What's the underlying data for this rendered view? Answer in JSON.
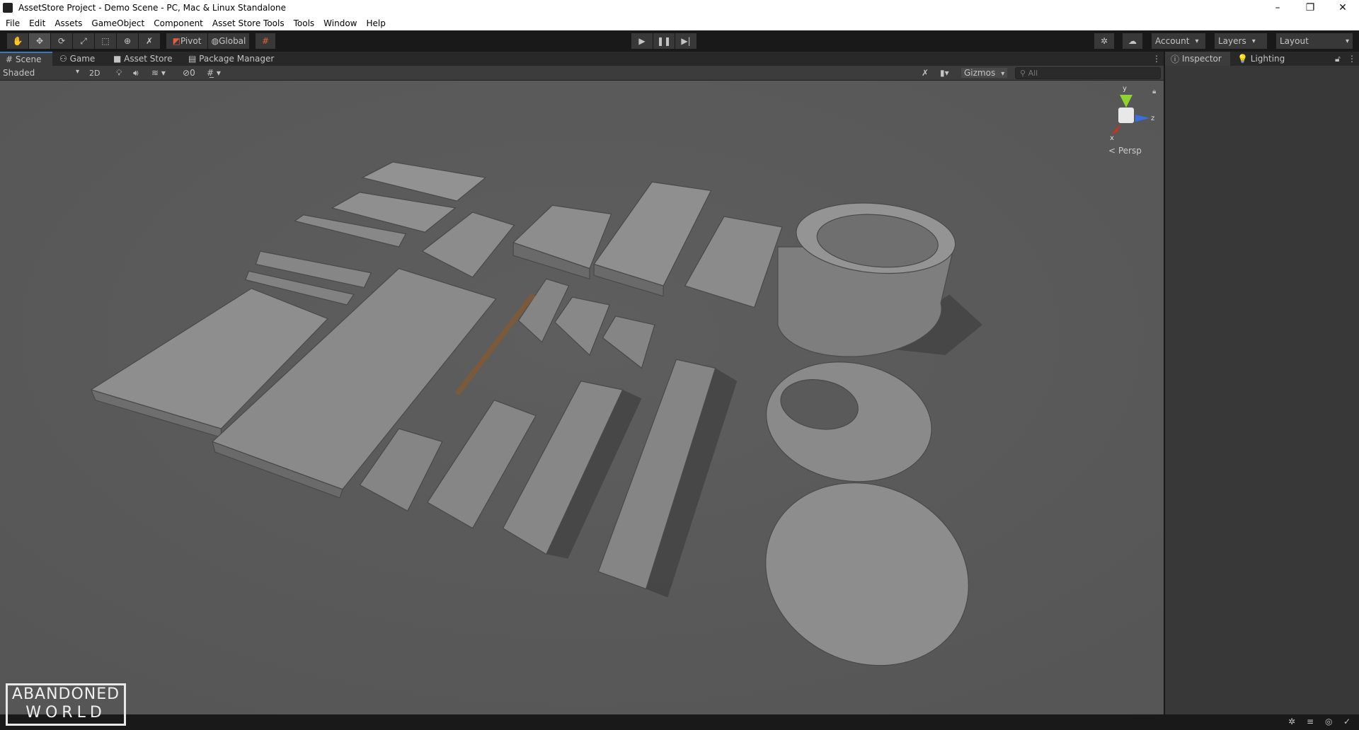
{
  "window": {
    "title": "AssetStore Project - Demo Scene - PC, Mac & Linux Standalone",
    "minimize": "–",
    "restore": "❐",
    "close": "✕"
  },
  "menu": [
    "File",
    "Edit",
    "Assets",
    "GameObject",
    "Component",
    "Asset Store Tools",
    "Tools",
    "Window",
    "Help"
  ],
  "toolbar": {
    "tools": [
      "hand-tool",
      "move-tool",
      "rotate-tool",
      "scale-tool",
      "rect-tool",
      "transform-tool",
      "custom-tool"
    ],
    "pivot": "Pivot",
    "global": "Global",
    "account": "Account",
    "layers": "Layers",
    "layout": "Layout"
  },
  "tabs": {
    "scene": "Scene",
    "game": "Game",
    "asset_store": "Asset Store",
    "package_manager": "Package Manager",
    "inspector": "Inspector",
    "lighting": "Lighting"
  },
  "scene_toolbar": {
    "shading": "Shaded",
    "mode_2d": "2D",
    "hidden_count": "0",
    "gizmos": "Gizmos",
    "search_placeholder": "All"
  },
  "gizmo": {
    "y": "y",
    "x": "x",
    "z": "z",
    "projection": "< Persp"
  },
  "logo": {
    "line1": "ABANDONED",
    "line2": "WORLD"
  },
  "colors": {
    "accent": "#3a79bb",
    "concrete": "#8a8a8a",
    "ground": "#5a5a5a"
  }
}
